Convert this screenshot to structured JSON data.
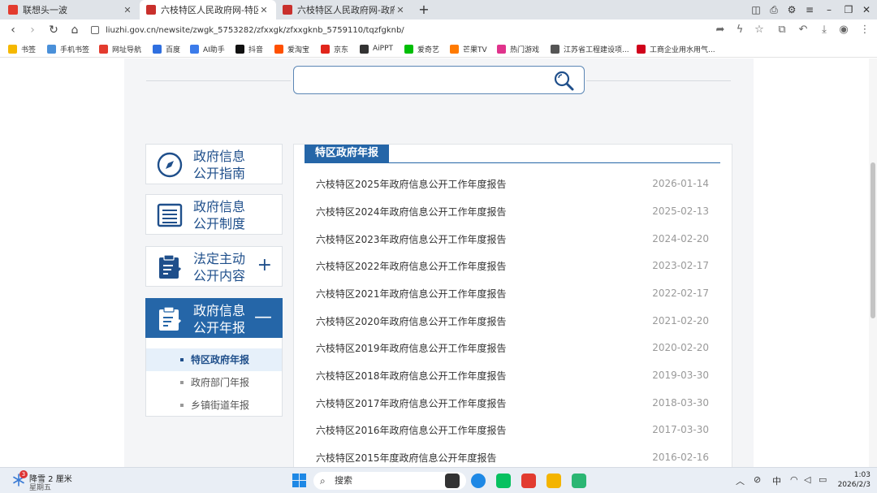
{
  "tabs": [
    {
      "title": "联想头一波",
      "active": false
    },
    {
      "title": "六枝特区人民政府网-特区政府年报",
      "active": true
    },
    {
      "title": "六枝特区人民政府网-政府部门年报",
      "active": false
    }
  ],
  "address": {
    "url": "liuzhi.gov.cn/newsite/zwgk_5753282/zfxxgk/zfxxgknb_5759110/tqzfgknb/"
  },
  "bookmarks": [
    "书签",
    "手机书签",
    "网址导航",
    "百度",
    "AI助手",
    "抖音",
    "爱淘宝",
    "京东",
    "AiPPT",
    "爱奇艺",
    "芒果TV",
    "热门游戏",
    "江苏省工程建设项...",
    "工商企业用水用气..."
  ],
  "sidebar": {
    "items": [
      {
        "label": "政府信息公开指南",
        "line1": "政府信息",
        "line2": "公开指南",
        "expander": ""
      },
      {
        "label": "政府信息公开制度",
        "line1": "政府信息",
        "line2": "公开制度",
        "expander": ""
      },
      {
        "label": "法定主动公开内容",
        "line1": "法定主动",
        "line2": "公开内容",
        "expander": "+"
      },
      {
        "label": "政府信息公开年报",
        "line1": "政府信息",
        "line2": "公开年报",
        "expander": "—"
      }
    ],
    "subitems": [
      "特区政府年报",
      "政府部门年报",
      "乡镇街道年报"
    ]
  },
  "panel": {
    "title": "特区政府年报",
    "rows": [
      {
        "title": "六枝特区2025年政府信息公开工作年度报告",
        "date": "2026-01-14"
      },
      {
        "title": "六枝特区2024年政府信息公开工作年度报告",
        "date": "2025-02-13"
      },
      {
        "title": "六枝特区2023年政府信息公开工作年度报告",
        "date": "2024-02-20"
      },
      {
        "title": "六枝特区2022年政府信息公开工作年度报告",
        "date": "2023-02-17"
      },
      {
        "title": "六枝特区2021年政府信息公开工作年度报告",
        "date": "2022-02-17"
      },
      {
        "title": "六枝特区2020年政府信息公开工作年度报告",
        "date": "2021-02-20"
      },
      {
        "title": "六枝特区2019年政府信息公开工作年度报告",
        "date": "2020-02-20"
      },
      {
        "title": "六枝特区2018年政府信息公开工作年度报告",
        "date": "2019-03-30"
      },
      {
        "title": "六枝特区2017年政府信息公开工作年度报告",
        "date": "2018-03-30"
      },
      {
        "title": "六枝特区2016年政府信息公开工作年度报告",
        "date": "2017-03-30"
      },
      {
        "title": "六枝特区2015年度政府信息公开年度报告",
        "date": "2016-02-16"
      }
    ]
  },
  "taskbar": {
    "weather_badge": "3",
    "weather_line1": "降雪 2 厘米",
    "weather_line2": "星期五",
    "search_label": "搜索",
    "ime": "中",
    "time": "1:03",
    "date": "2026/2/3"
  },
  "colors": {
    "primary": "#2566a8",
    "accent_text": "#1f4f8b",
    "date_gray": "#999999"
  }
}
